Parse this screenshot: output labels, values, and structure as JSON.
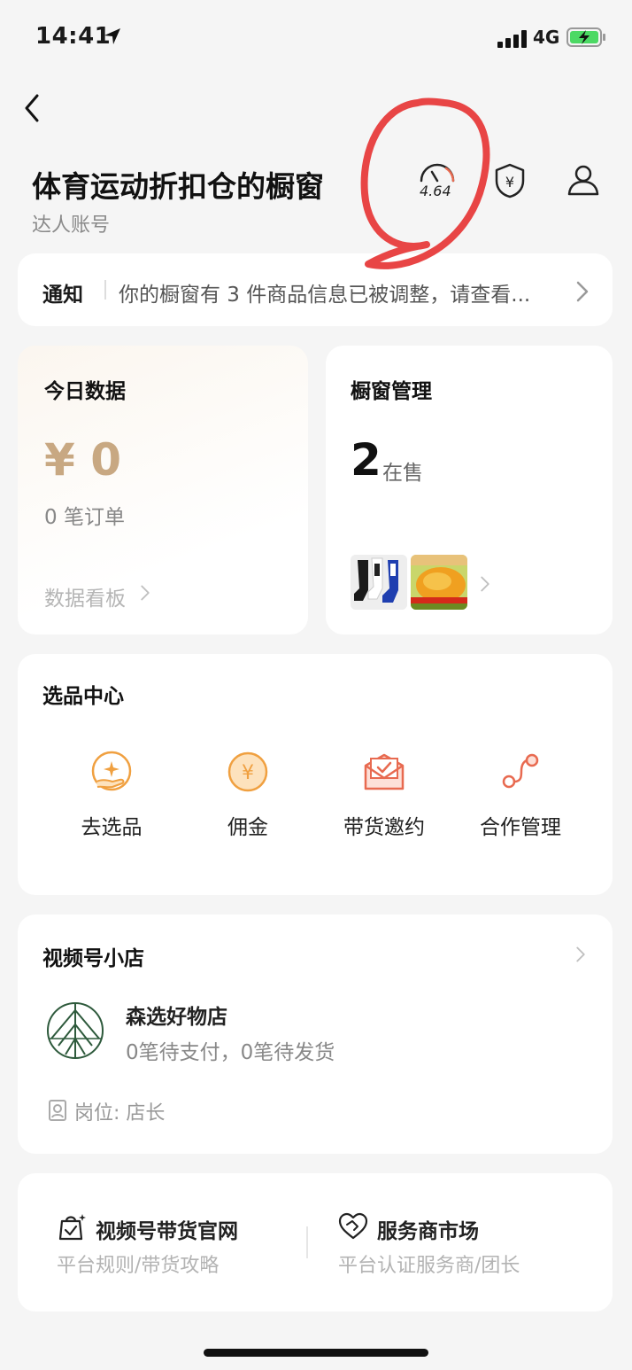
{
  "status_bar": {
    "time": "14:41",
    "network": "4G"
  },
  "header": {
    "title": "体育运动折扣仓的橱窗",
    "subtitle": "达人账号",
    "score": "4.64"
  },
  "notice": {
    "label": "通知",
    "text": "你的橱窗有 3 件商品信息已被调整，请查看..."
  },
  "today_data": {
    "title": "今日数据",
    "amount": "¥ 0",
    "orders": "0 笔订单",
    "link": "数据看板"
  },
  "window_mgmt": {
    "title": "橱窗管理",
    "count": "2",
    "count_label": "在售"
  },
  "selection_center": {
    "title": "选品中心",
    "tools": [
      {
        "label": "去选品",
        "icon": "hand-star-icon"
      },
      {
        "label": "佣金",
        "icon": "yen-coin-icon"
      },
      {
        "label": "带货邀约",
        "icon": "envelope-check-icon"
      },
      {
        "label": "合作管理",
        "icon": "link-nodes-icon"
      }
    ]
  },
  "shop": {
    "title": "视频号小店",
    "name": "森选好物店",
    "stats": "0笔待支付，0笔待发货",
    "role": "岗位: 店长"
  },
  "links": [
    {
      "title": "视频号带货官网",
      "sub": "平台规则/带货攻略",
      "icon": "bag-check-icon"
    },
    {
      "title": "服务商市场",
      "sub": "平台认证服务商/团长",
      "icon": "heart-handshake-icon"
    }
  ],
  "colors": {
    "accent_gold": "#c8a882",
    "icon_orange": "#f0a040",
    "icon_red": "#e86a50",
    "annotation_red": "#e84545"
  }
}
